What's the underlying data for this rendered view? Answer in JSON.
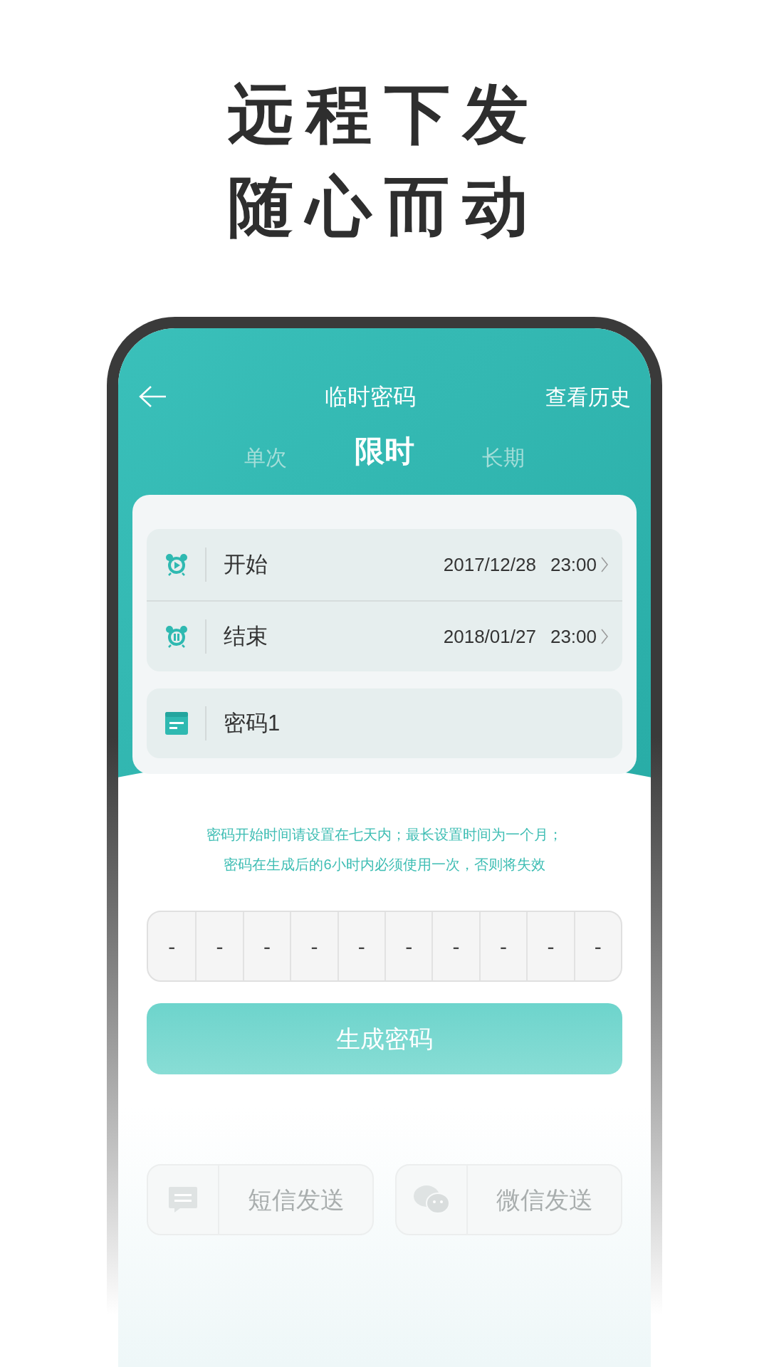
{
  "headline": [
    "远程下发",
    "随心而动"
  ],
  "nav": {
    "title": "临时密码",
    "action": "查看历史"
  },
  "tabs": [
    {
      "label": "单次",
      "selected": false
    },
    {
      "label": "限时",
      "selected": true
    },
    {
      "label": "长期",
      "selected": false
    }
  ],
  "time_rows": [
    {
      "kind": "start",
      "label": "开始",
      "date": "2017/12/28",
      "time": "23:00"
    },
    {
      "kind": "end",
      "label": "结束",
      "date": "2018/01/27",
      "time": "23:00"
    }
  ],
  "name_field": {
    "value": "密码1"
  },
  "hint": [
    "密码开始时间请设置在七天内；最长设置时间为一个月；",
    "密码在生成后的6小时内必须使用一次，否则将失效"
  ],
  "code_digits": [
    "-",
    "-",
    "-",
    "-",
    "-",
    "-",
    "-",
    "-",
    "-",
    "-"
  ],
  "generate_button": "生成密码",
  "share_buttons": [
    {
      "kind": "sms",
      "label": "短信发送",
      "disabled": true
    },
    {
      "kind": "wechat",
      "label": "微信发送",
      "disabled": true
    }
  ]
}
